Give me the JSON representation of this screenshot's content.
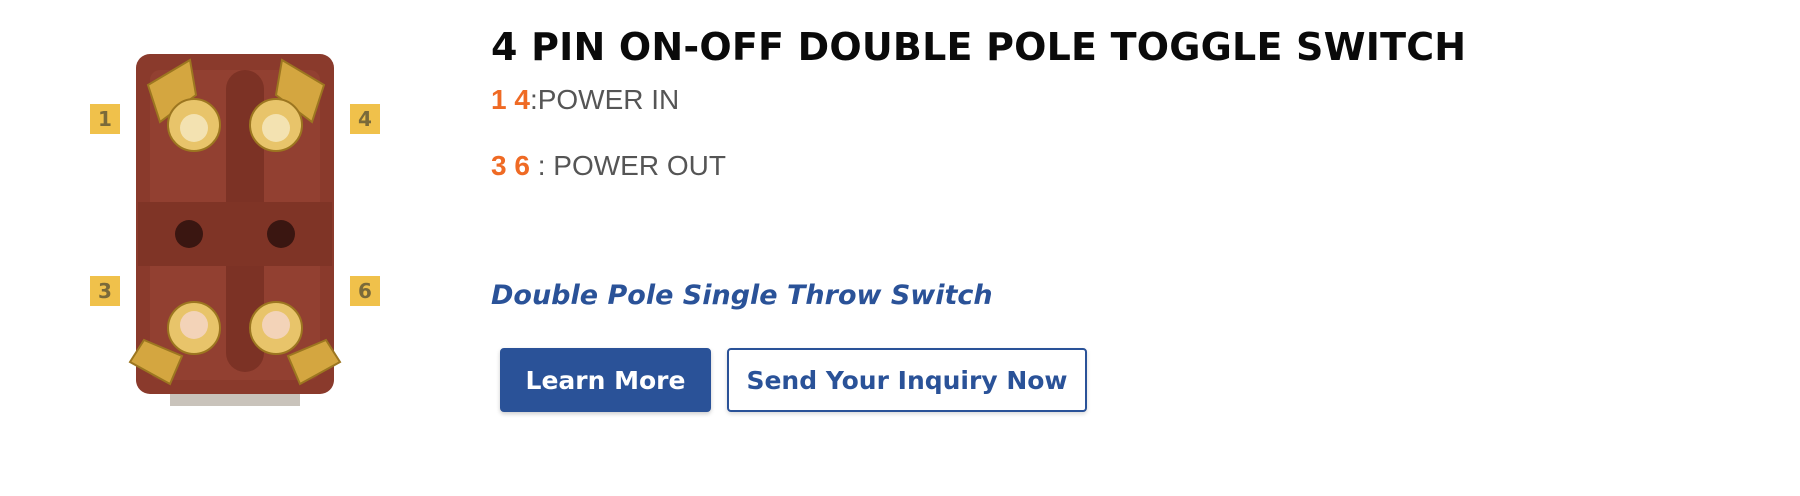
{
  "product": {
    "title": "4 PIN ON-OFF DOUBLE POLE TOGGLE SWITCH",
    "image": {
      "pin_labels": [
        "1",
        "4",
        "3",
        "6"
      ],
      "colors": {
        "body": "#8a3a2c",
        "terminal": "#d4a640",
        "label_bg": "#f0c14b",
        "label_text": "#7a6a3a"
      }
    },
    "pin_rows": [
      {
        "pins": "1 4",
        "separator": ":",
        "description": "POWER IN"
      },
      {
        "pins": "3 6",
        "separator": " : ",
        "description": "POWER OUT"
      }
    ],
    "subtitle": "Double Pole Single Throw Switch",
    "buttons": {
      "learn_more": "Learn More",
      "inquiry": "Send Your Inquiry Now"
    },
    "colors": {
      "accent": "#ef6a24",
      "brand": "#2a5298",
      "title": "#0a0a0a",
      "body_text": "#555555"
    }
  }
}
